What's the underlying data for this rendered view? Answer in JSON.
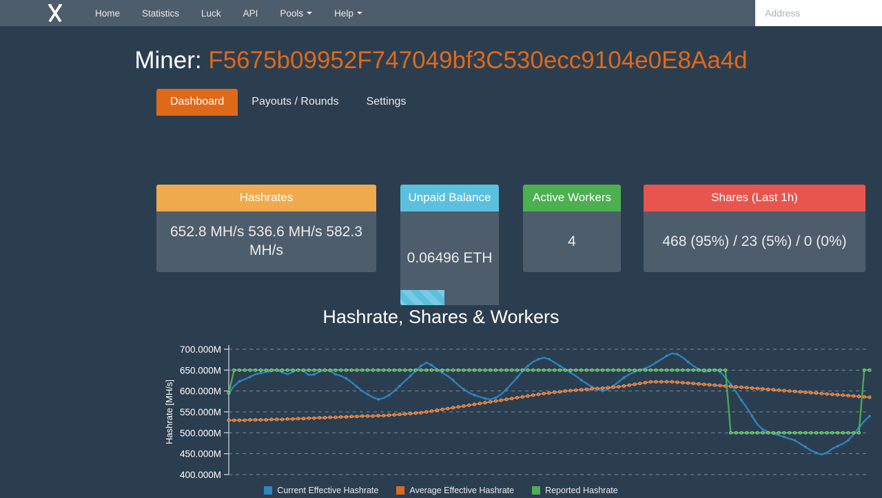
{
  "navbar": {
    "logo_icon": "crossed-hammers-icon",
    "links": [
      {
        "label": "Home",
        "dropdown": false
      },
      {
        "label": "Statistics",
        "dropdown": false
      },
      {
        "label": "Luck",
        "dropdown": false
      },
      {
        "label": "API",
        "dropdown": false
      },
      {
        "label": "Pools",
        "dropdown": true
      },
      {
        "label": "Help",
        "dropdown": true
      }
    ],
    "search": {
      "placeholder": "Address",
      "value": ""
    }
  },
  "header": {
    "label": "Miner: ",
    "address": "F5675b09952F747049bf3C530ecc9104e0E8Aa4d"
  },
  "tabs": [
    {
      "label": "Dashboard",
      "active": true
    },
    {
      "label": "Payouts / Rounds",
      "active": false
    },
    {
      "label": "Settings",
      "active": false
    }
  ],
  "cards": {
    "hashrates": {
      "title": "Hashrates",
      "value": "652.8 MH/s  536.6 MH/s 582.3 MH/s",
      "header_color": "#eeaa4d"
    },
    "unpaid_balance": {
      "title": "Unpaid Balance",
      "value": "0.06496 ETH",
      "header_color": "#5bc0de",
      "progress_percent": 45
    },
    "active_workers": {
      "title": "Active Workers",
      "value": "4",
      "header_color": "#4caf50"
    },
    "shares": {
      "title": "Shares (Last 1h)",
      "value": "468 (95%) / 23 (5%) / 0 (0%)",
      "header_color": "#e8554e"
    }
  },
  "chart_data": {
    "type": "line",
    "title": "Hashrate, Shares & Workers",
    "xlabel": "",
    "ylabel": "Hashrate [MH/s]",
    "ylim": [
      400000000,
      700000000
    ],
    "ytick_labels": [
      "700.000M",
      "650.000M",
      "600.000M",
      "550.000M",
      "500.000M",
      "450.000M",
      "400.000M"
    ],
    "ytick_values": [
      700000000,
      650000000,
      600000000,
      550000000,
      500000000,
      450000000,
      400000000
    ],
    "grid": true,
    "legend_position": "bottom",
    "x_count": 120,
    "series": [
      {
        "name": "Current Effective Hashrate",
        "color": "#2e86c1",
        "values": [
          595,
          612,
          623,
          628,
          634,
          640,
          643,
          645,
          648,
          650,
          645,
          640,
          646,
          652,
          648,
          638,
          640,
          646,
          650,
          648,
          640,
          636,
          630,
          621,
          610,
          600,
          592,
          585,
          580,
          583,
          590,
          600,
          612,
          624,
          636,
          648,
          660,
          668,
          662,
          652,
          644,
          636,
          626,
          614,
          604,
          596,
          590,
          586,
          582,
          580,
          584,
          592,
          604,
          618,
          632,
          648,
          660,
          670,
          676,
          680,
          676,
          668,
          660,
          652,
          644,
          636,
          626,
          618,
          610,
          604,
          600,
          604,
          612,
          622,
          632,
          640,
          646,
          650,
          654,
          660,
          668,
          676,
          684,
          690,
          688,
          680,
          670,
          660,
          652,
          646,
          648,
          652,
          646,
          632,
          616,
          598,
          578,
          560,
          540,
          520,
          508,
          502,
          498,
          494,
          490,
          486,
          482,
          474,
          466,
          458,
          452,
          448,
          452,
          462,
          468,
          474,
          482,
          496,
          512,
          528,
          540
        ],
        "start_value": 595,
        "end_value": 540
      },
      {
        "name": "Average Effective Hashrate",
        "color": "#df691a",
        "values": [
          530,
          530,
          530,
          530,
          531,
          531,
          531,
          531,
          532,
          532,
          532,
          533,
          533,
          534,
          534,
          535,
          535,
          536,
          536,
          537,
          537,
          538,
          538,
          539,
          539,
          540,
          540,
          540,
          541,
          541,
          542,
          543,
          544,
          545,
          546,
          547,
          548,
          550,
          552,
          554,
          556,
          558,
          560,
          562,
          564,
          566,
          568,
          570,
          572,
          574,
          576,
          578,
          580,
          582,
          584,
          586,
          588,
          590,
          592,
          594,
          595,
          597,
          598,
          600,
          601,
          602,
          603,
          604,
          605,
          606,
          607,
          608,
          609,
          610,
          612,
          614,
          616,
          618,
          620,
          622,
          622,
          622,
          622,
          622,
          621,
          620,
          619,
          618,
          617,
          616,
          615,
          614,
          613,
          612,
          611,
          610,
          609,
          608,
          607,
          606,
          605,
          604,
          603,
          602,
          601,
          600,
          599,
          598,
          597,
          596,
          595,
          594,
          593,
          592,
          591,
          590,
          589,
          588,
          587,
          586,
          585
        ],
        "start_value": 530,
        "end_value": 585
      },
      {
        "name": "Reported Hashrate",
        "color": "#4caf50",
        "values": [
          595,
          650,
          650,
          650,
          650,
          650,
          650,
          650,
          650,
          650,
          650,
          650,
          650,
          650,
          650,
          650,
          650,
          650,
          650,
          650,
          650,
          650,
          650,
          650,
          650,
          650,
          650,
          650,
          650,
          650,
          650,
          650,
          650,
          650,
          650,
          650,
          650,
          650,
          650,
          650,
          650,
          650,
          650,
          650,
          650,
          650,
          650,
          650,
          650,
          650,
          650,
          650,
          650,
          650,
          650,
          650,
          650,
          650,
          650,
          650,
          650,
          650,
          650,
          650,
          650,
          650,
          650,
          650,
          650,
          650,
          650,
          650,
          650,
          650,
          650,
          650,
          650,
          650,
          650,
          650,
          650,
          650,
          650,
          650,
          650,
          650,
          650,
          650,
          650,
          650,
          650,
          650,
          650,
          650,
          500,
          500,
          500,
          500,
          500,
          500,
          500,
          500,
          500,
          500,
          500,
          500,
          500,
          500,
          500,
          500,
          500,
          500,
          500,
          500,
          500,
          500,
          500,
          500,
          500,
          650,
          650
        ],
        "start_value": 595,
        "end_value": 650
      }
    ]
  }
}
